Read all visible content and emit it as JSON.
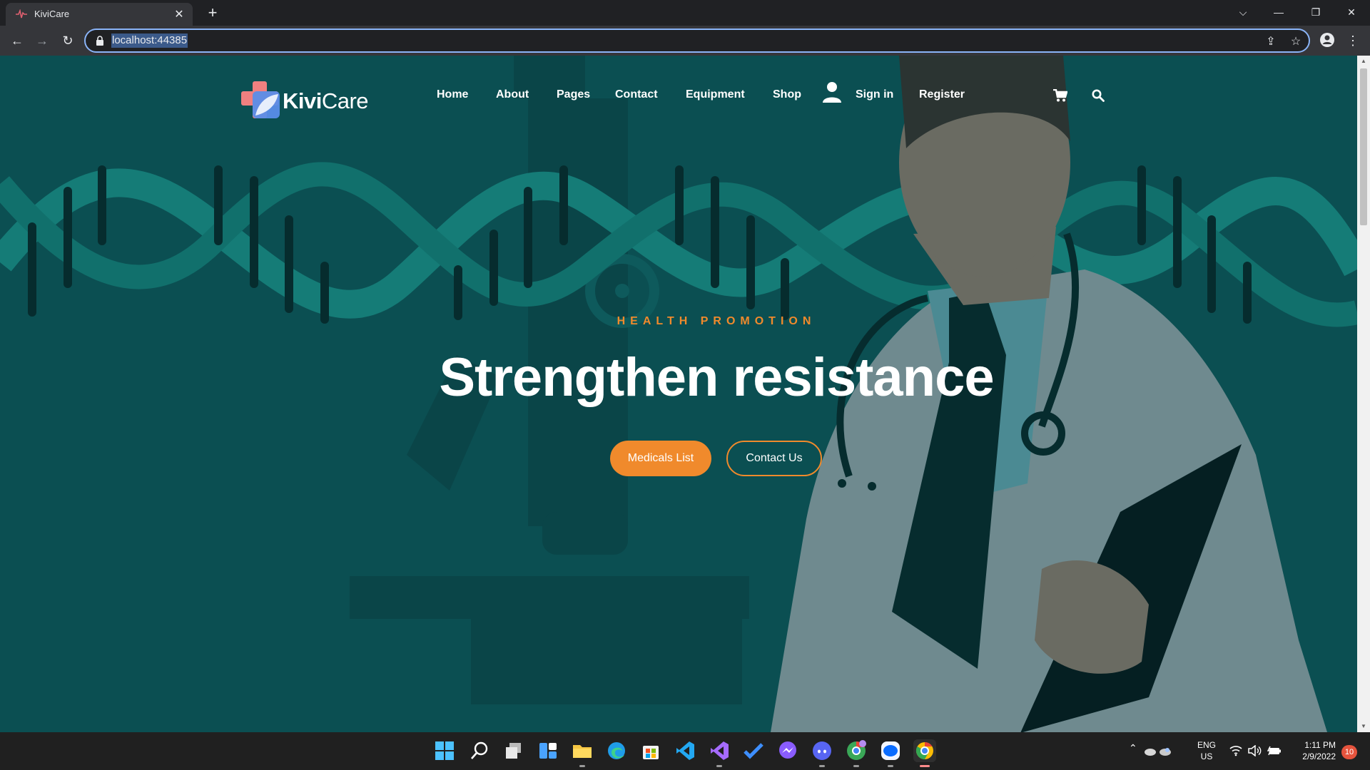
{
  "browser": {
    "tab_title": "KiviCare",
    "url": "localhost:44385"
  },
  "site": {
    "logo_kivi": "Kivi",
    "logo_care": "Care",
    "nav": [
      "Home",
      "About",
      "Pages",
      "Contact",
      "Equipment",
      "Shop"
    ],
    "sign_in": "Sign in",
    "register": "Register"
  },
  "hero": {
    "kicker": "HEALTH PROMOTION",
    "headline": "Strengthen resistance",
    "primary_button": "Medicals List",
    "secondary_button": "Contact Us"
  },
  "taskbar": {
    "lang_line1": "ENG",
    "lang_line2": "US",
    "time": "1:11 PM",
    "date": "2/9/2022",
    "notifications": "10"
  },
  "colors": {
    "accent": "#f08a2c",
    "hero_bg": "#0b4f52",
    "dna": "#1a8a84"
  }
}
